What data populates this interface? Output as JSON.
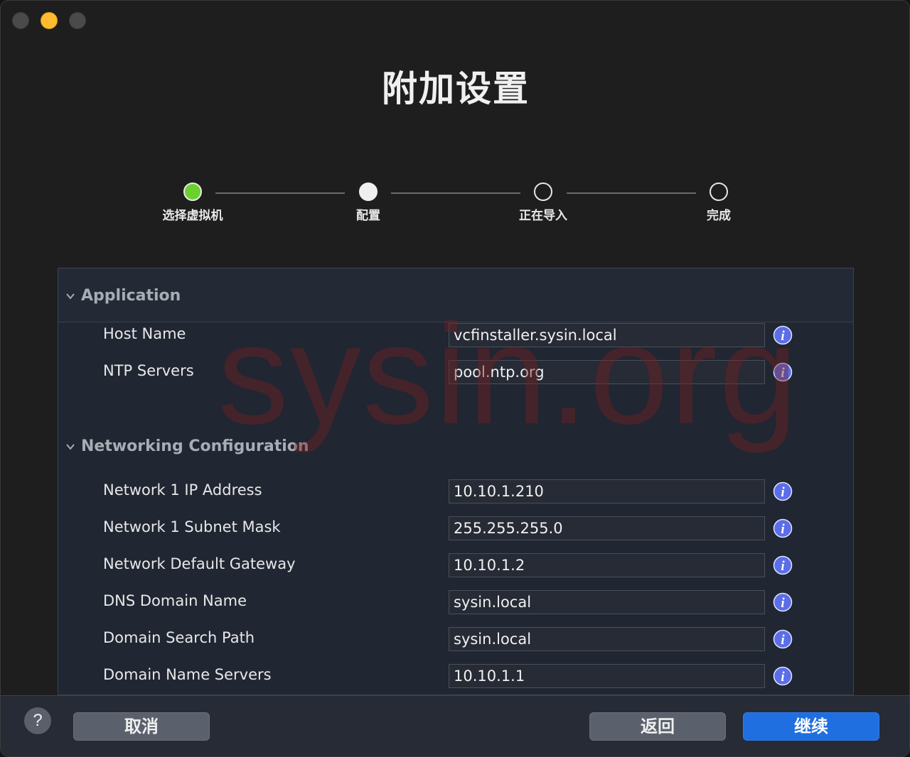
{
  "window": {
    "title": "附加设置"
  },
  "stepper": {
    "steps": [
      {
        "label": "选择虚拟机",
        "state": "done"
      },
      {
        "label": "配置",
        "state": "current"
      },
      {
        "label": "正在导入",
        "state": "pending"
      },
      {
        "label": "完成",
        "state": "pending"
      }
    ]
  },
  "watermark": "sysin.org",
  "sections": {
    "application": {
      "label": "Application",
      "rows": [
        {
          "label": "Host Name",
          "value": "vcfinstaller.sysin.local"
        },
        {
          "label": "NTP Servers",
          "value": "pool.ntp.org"
        }
      ]
    },
    "networking": {
      "label": "Networking Configuration",
      "rows": [
        {
          "label": "Network 1 IP Address",
          "value": "10.10.1.210"
        },
        {
          "label": "Network 1 Subnet Mask",
          "value": "255.255.255.0"
        },
        {
          "label": "Network Default Gateway",
          "value": "10.10.1.2"
        },
        {
          "label": "DNS Domain Name",
          "value": "sysin.local"
        },
        {
          "label": "Domain Search Path",
          "value": "sysin.local"
        },
        {
          "label": "Domain Name Servers",
          "value": "10.10.1.1"
        }
      ]
    }
  },
  "footer": {
    "help": "?",
    "cancel": "取消",
    "back": "返回",
    "continue": "继续"
  },
  "colors": {
    "accent": "#1f6fe0",
    "step_done": "#6ad12e",
    "info_icon": "#5b6ee8"
  }
}
